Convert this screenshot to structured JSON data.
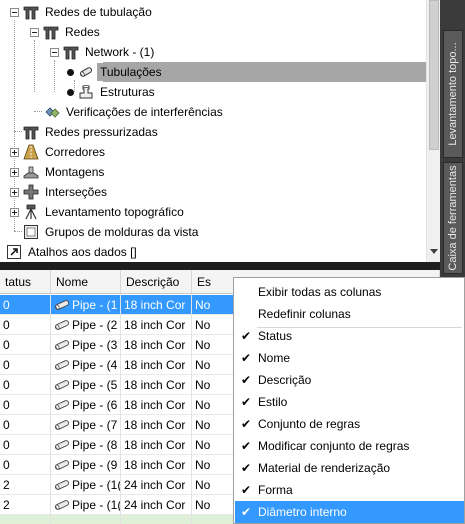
{
  "tree": {
    "items": [
      {
        "label": "Redes de tubulação",
        "icon": "pipe-network-icon",
        "expander": "minus"
      },
      {
        "label": "Redes",
        "icon": "pipe-network-icon",
        "expander": "minus"
      },
      {
        "label": "Network - (1)",
        "icon": "pipe-network-icon",
        "expander": "minus"
      },
      {
        "label": "Tubulações",
        "icon": "pipe-icon",
        "expander": "dot",
        "selected": true
      },
      {
        "label": "Estruturas",
        "icon": "structure-icon",
        "expander": "dot"
      },
      {
        "label": "Verificações de interferências",
        "icon": "interference-check-icon",
        "expander": "none"
      },
      {
        "label": "Redes pressurizadas",
        "icon": "pressure-network-icon",
        "expander": "none"
      },
      {
        "label": "Corredores",
        "icon": "corridor-icon",
        "expander": "plus"
      },
      {
        "label": "Montagens",
        "icon": "assembly-icon",
        "expander": "plus"
      },
      {
        "label": "Interseções",
        "icon": "intersection-icon",
        "expander": "plus"
      },
      {
        "label": "Levantamento topográfico",
        "icon": "survey-icon",
        "expander": "plus"
      },
      {
        "label": "Grupos de molduras da vista",
        "icon": "view-frame-group-icon",
        "expander": "none"
      },
      {
        "label": "Atalhos aos dados []",
        "icon": "data-shortcuts-icon",
        "expander": "none"
      }
    ]
  },
  "side_tabs": {
    "survey": "Levantamento topo...",
    "toolbox": "Caixa de ferramentas"
  },
  "grid": {
    "columns": [
      "tatus",
      "Nome",
      "Descrição",
      "Es"
    ],
    "rows": [
      {
        "status": "0",
        "name": "Pipe - (1",
        "description": "18 inch Cor",
        "style": "No",
        "selected": true
      },
      {
        "status": "0",
        "name": "Pipe - (2",
        "description": "18 inch Cor",
        "style": "No"
      },
      {
        "status": "0",
        "name": "Pipe - (3",
        "description": "18 inch Cor",
        "style": "No"
      },
      {
        "status": "0",
        "name": "Pipe - (4",
        "description": "18 inch Cor",
        "style": "No"
      },
      {
        "status": "0",
        "name": "Pipe - (5",
        "description": "18 inch Cor",
        "style": "No"
      },
      {
        "status": "0",
        "name": "Pipe - (6",
        "description": "18 inch Cor",
        "style": "No"
      },
      {
        "status": "0",
        "name": "Pipe - (7",
        "description": "18 inch Cor",
        "style": "No"
      },
      {
        "status": "0",
        "name": "Pipe - (8",
        "description": "18 inch Cor",
        "style": "No"
      },
      {
        "status": "0",
        "name": "Pipe - (9",
        "description": "18 inch Cor",
        "style": "No"
      },
      {
        "status": "2",
        "name": "Pipe - (1(",
        "description": "24 inch Cor",
        "style": "No"
      },
      {
        "status": "2",
        "name": "Pipe - (1(",
        "description": "24 inch Cor",
        "style": "No"
      }
    ]
  },
  "context_menu": {
    "top_items": [
      "Exibir todas as colunas",
      "Redefinir colunas"
    ],
    "column_items": [
      {
        "label": "Status",
        "checked": true
      },
      {
        "label": "Nome",
        "checked": true
      },
      {
        "label": "Descrição",
        "checked": true
      },
      {
        "label": "Estilo",
        "checked": true
      },
      {
        "label": "Conjunto de regras",
        "checked": true
      },
      {
        "label": "Modificar conjunto de regras",
        "checked": true
      },
      {
        "label": "Material de renderização",
        "checked": true
      },
      {
        "label": "Forma",
        "checked": true
      },
      {
        "label": "Diâmetro interno",
        "checked": true,
        "highlighted": true
      }
    ],
    "check_glyph": "✔"
  },
  "colors": {
    "selection_blue": "#3399ff",
    "tree_selection_gray": "#a6a6a6",
    "splitter_dark": "#1e1e1e",
    "palette_dark": "#3b3b3b"
  }
}
